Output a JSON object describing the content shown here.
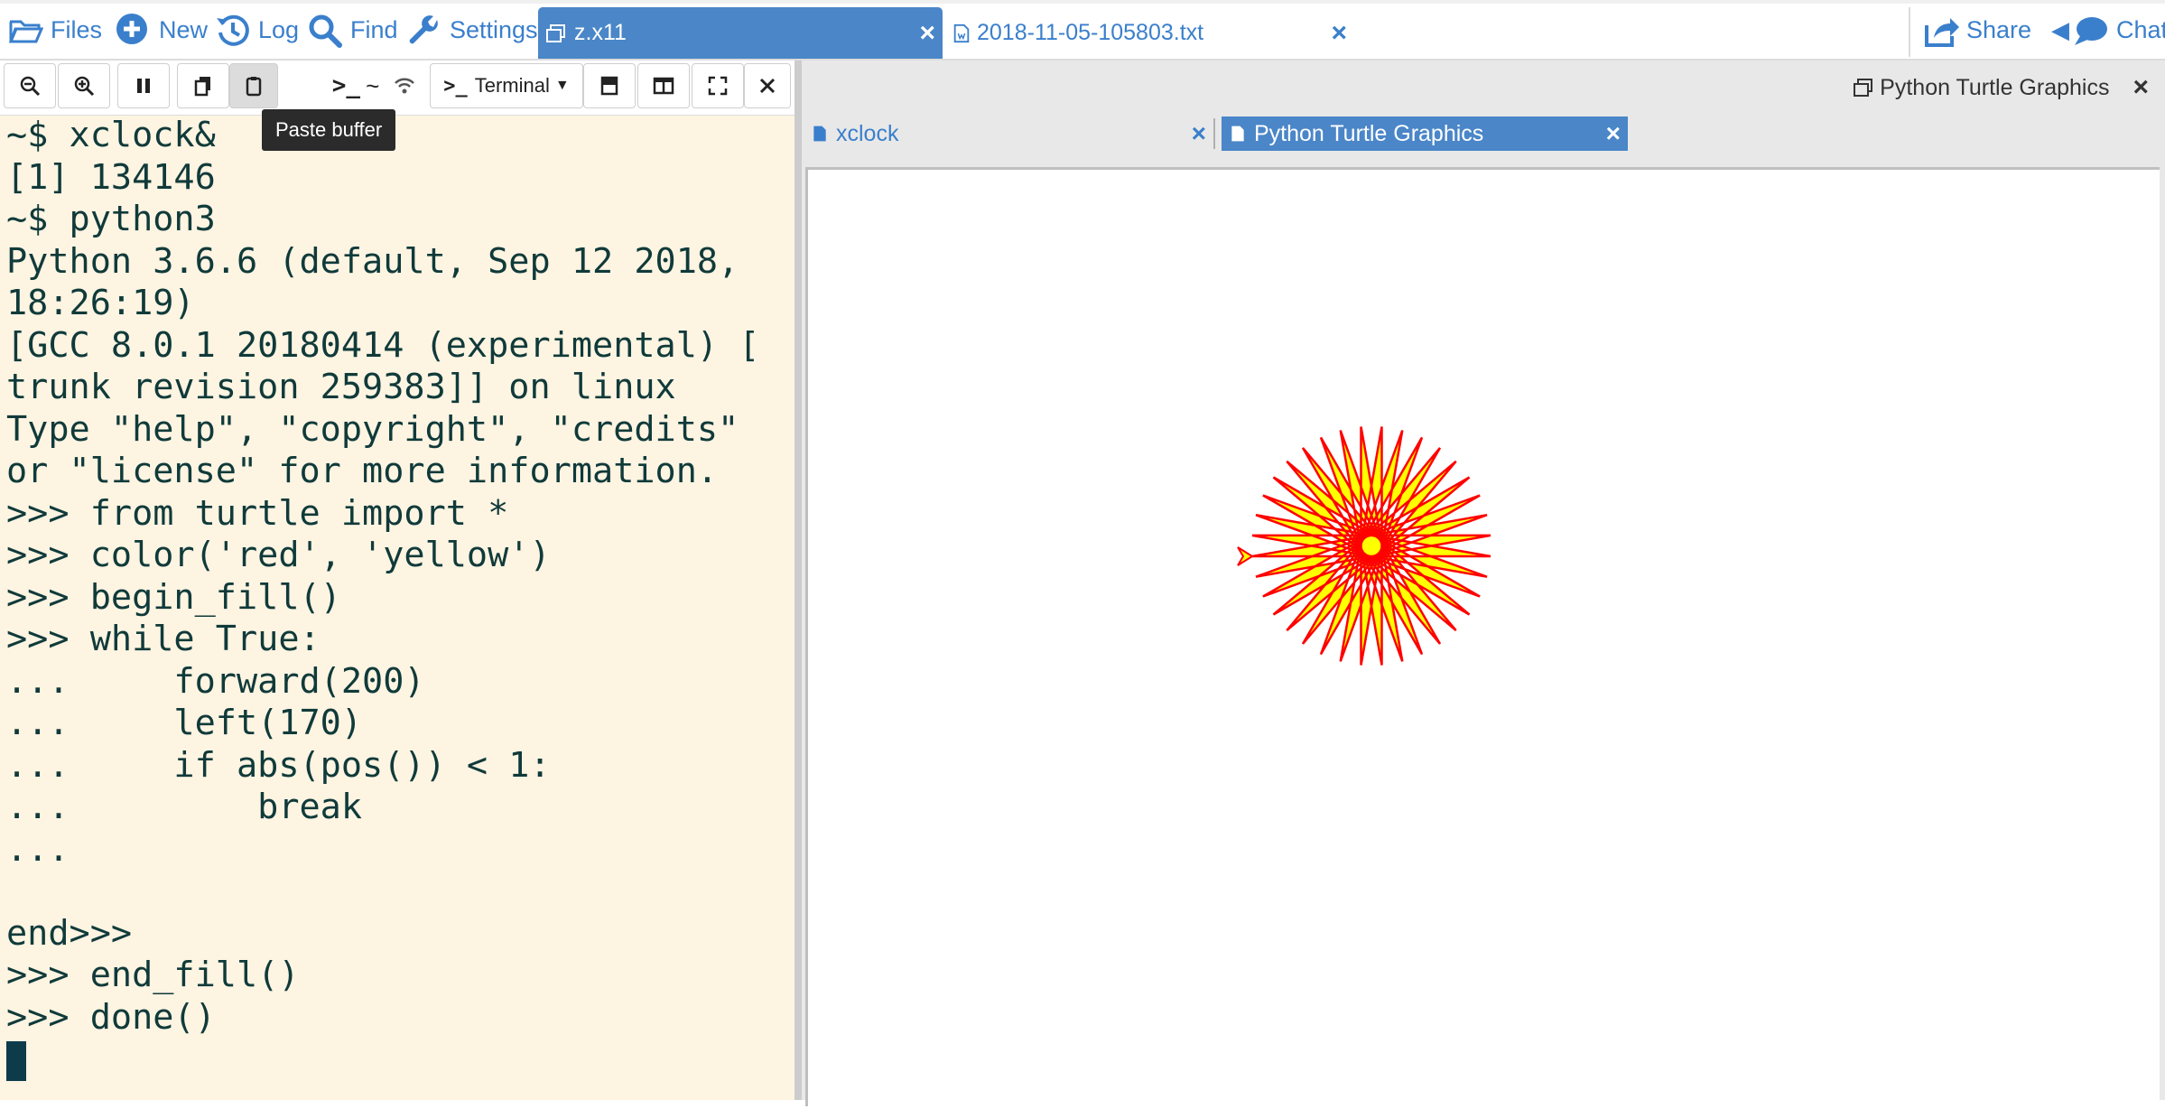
{
  "topbar": {
    "menu": [
      {
        "label": "Files",
        "icon": "folder-open-icon"
      },
      {
        "label": "New",
        "icon": "plus-circle-icon"
      },
      {
        "label": "Log",
        "icon": "history-icon"
      },
      {
        "label": "Find",
        "icon": "search-icon"
      },
      {
        "label": "Settings",
        "icon": "wrench-icon"
      }
    ],
    "tabs": [
      {
        "label": "z.x11",
        "active": true
      },
      {
        "label": "2018-11-05-105803.txt",
        "active": false
      }
    ],
    "share_label": "Share",
    "chat_label": "Chat"
  },
  "terminal": {
    "tooltip": "Paste buffer",
    "home_label": "~",
    "mode_label": "Terminal",
    "lines": [
      "~$ xclock&",
      "[1] 134146",
      "~$ python3",
      "Python 3.6.6 (default, Sep 12 2018,",
      "18:26:19)",
      "[GCC 8.0.1 20180414 (experimental) [",
      "trunk revision 259383]] on linux",
      "Type \"help\", \"copyright\", \"credits\"",
      "or \"license\" for more information.",
      ">>> from turtle import *",
      ">>> color('red', 'yellow')",
      ">>> begin_fill()",
      ">>> while True:",
      "...     forward(200)",
      "...     left(170)",
      "...     if abs(pos()) < 1:",
      "...         break",
      "...",
      "",
      "end>>>",
      ">>> end_fill()",
      ">>> done()"
    ]
  },
  "right": {
    "window_title": "Python Turtle Graphics",
    "tabs": [
      {
        "label": "xclock",
        "active": false
      },
      {
        "label": "Python Turtle Graphics",
        "active": true
      }
    ],
    "colors": {
      "stroke": "#ff0000",
      "fill": "#ffff00",
      "accent": "#4a86c8"
    }
  }
}
